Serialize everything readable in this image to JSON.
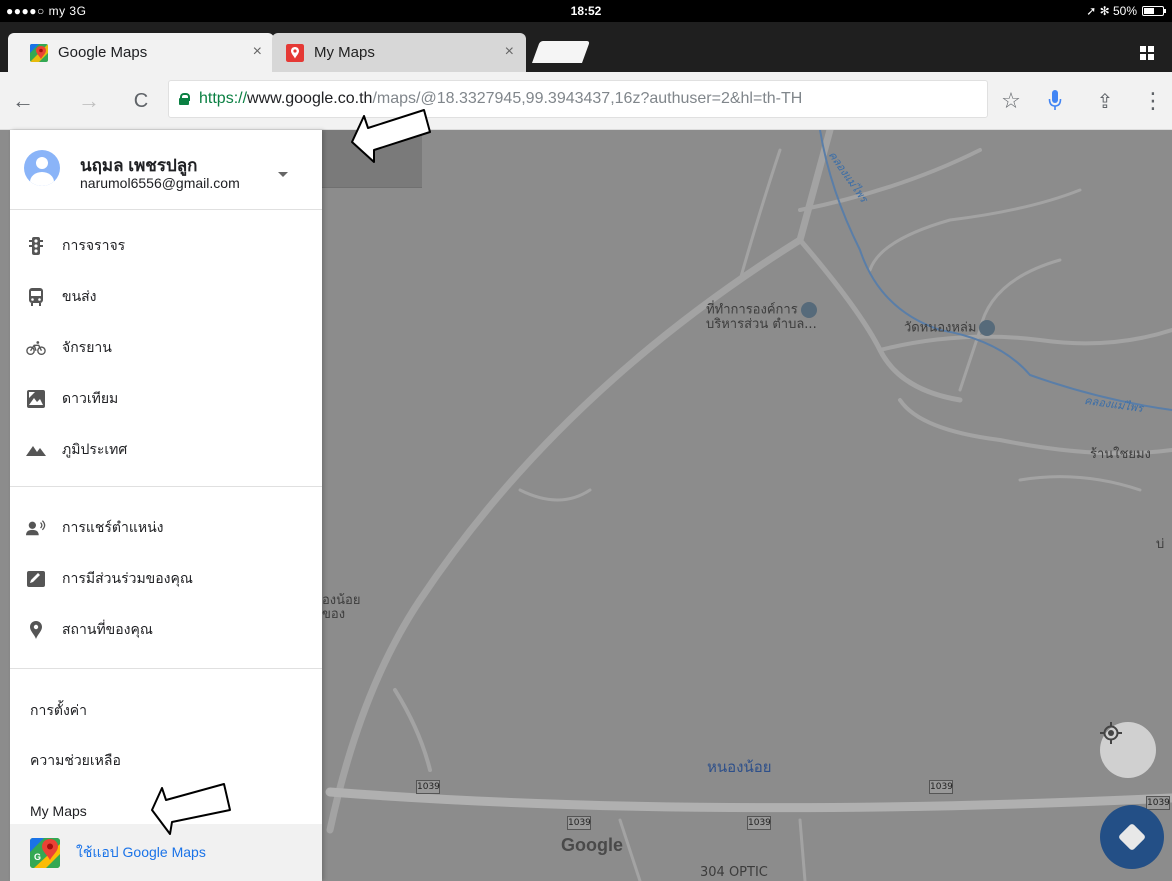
{
  "status_bar": {
    "carrier": "●●●●○ my  3G",
    "time": "18:52",
    "right": "➚ ✻ 50%"
  },
  "tabs": [
    {
      "title": "Google Maps",
      "close": "×"
    },
    {
      "title": "My Maps",
      "close": "×"
    }
  ],
  "toolbar": {
    "back": "←",
    "forward": "→",
    "reload": "C",
    "url_scheme": "https://",
    "url_host": "www.google.co.th",
    "url_path": "/maps/@18.3327945,99.3943437,16z?authuser=2&hl=th-TH",
    "star": "☆",
    "mic": "mic-icon",
    "share": "⇪",
    "menu": "⋮"
  },
  "account": {
    "name": "นฤมล เพชรปลูก",
    "email": "narumol6556@gmail.com"
  },
  "layers": [
    {
      "label": "การจราจร",
      "icon": "traffic-icon"
    },
    {
      "label": "ขนส่ง",
      "icon": "transit-icon"
    },
    {
      "label": "จักรยาน",
      "icon": "bike-icon"
    },
    {
      "label": "ดาวเทียม",
      "icon": "satellite-icon"
    },
    {
      "label": "ภูมิประเทศ",
      "icon": "terrain-icon"
    }
  ],
  "personal": [
    {
      "label": "การแชร์ตำแหน่ง",
      "icon": "location-share-icon"
    },
    {
      "label": "การมีส่วนร่วมของคุณ",
      "icon": "contribution-icon"
    },
    {
      "label": "สถานที่ของคุณ",
      "icon": "place-icon"
    }
  ],
  "footer_items": [
    {
      "label": "การตั้งค่า"
    },
    {
      "label": "ความช่วยเหลือ"
    },
    {
      "label": "My Maps"
    }
  ],
  "app_link": {
    "label": "ใช้แอป Google Maps"
  },
  "map": {
    "labels": {
      "poi1_line1": "ที่ทำการองค์การ",
      "poi1_line2": "บริหารส่วน ตำบล...",
      "temple": "วัดหนองหล่ม",
      "shop": "ร้านใชยมง",
      "left1": "องน้อย",
      "left2": "ของ",
      "town": "หนองน้อย",
      "right_edge": "บ่",
      "stream1": "คลองแม่ไพร",
      "stream2": "คลองแม่ไพร",
      "bottom_poi": "304 OPTIC"
    },
    "road_shield": "1039",
    "logo": "Google"
  },
  "colors": {
    "drawer_bg": "#ffffff",
    "map_overlay": "#8c8c8c",
    "link_blue": "#1a73e8",
    "secure_green": "#0b8043"
  }
}
